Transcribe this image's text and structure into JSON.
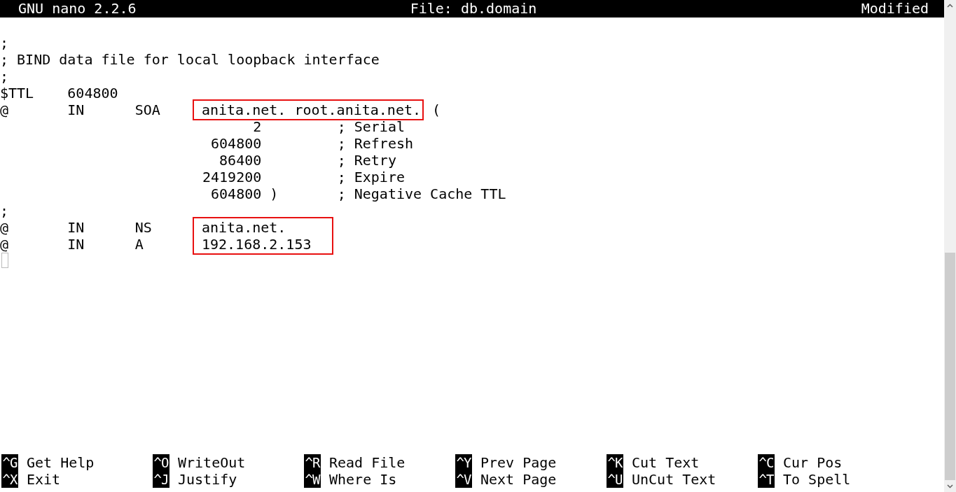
{
  "title_bar": {
    "app": "GNU nano 2.2.6",
    "file": "File: db.domain",
    "status": "Modified"
  },
  "editor": {
    "lines": [
      {
        "kind": "blank"
      },
      {
        "kind": "line",
        "text": ";"
      },
      {
        "kind": "line",
        "text": "; BIND data file for local loopback interface"
      },
      {
        "kind": "line",
        "text": ";"
      },
      {
        "kind": "line",
        "text": "$TTL    604800"
      },
      {
        "kind": "annotated",
        "rows": [
          {
            "lead": "@       IN      SOA    ",
            "value": "anita.net. root.anita.net.",
            "tail": " ("
          }
        ]
      },
      {
        "kind": "line",
        "text": "                              2         ; Serial"
      },
      {
        "kind": "line",
        "text": "                         604800         ; Refresh"
      },
      {
        "kind": "line",
        "text": "                          86400         ; Retry"
      },
      {
        "kind": "line",
        "text": "                        2419200         ; Expire"
      },
      {
        "kind": "line",
        "text": "                         604800 )       ; Negative Cache TTL"
      },
      {
        "kind": "line",
        "text": ";"
      },
      {
        "kind": "annotated",
        "rows": [
          {
            "lead": "@       IN      NS     ",
            "value": "anita.net."
          },
          {
            "lead": "@       IN      A      ",
            "value": "192.168.2.153"
          }
        ]
      },
      {
        "kind": "cursor"
      }
    ]
  },
  "shortcuts": [
    [
      {
        "key": "^G",
        "label": "Get Help"
      },
      {
        "key": "^O",
        "label": "WriteOut"
      },
      {
        "key": "^R",
        "label": "Read File"
      },
      {
        "key": "^Y",
        "label": "Prev Page"
      },
      {
        "key": "^K",
        "label": "Cut Text"
      },
      {
        "key": "^C",
        "label": "Cur Pos"
      }
    ],
    [
      {
        "key": "^X",
        "label": "Exit"
      },
      {
        "key": "^J",
        "label": "Justify"
      },
      {
        "key": "^W",
        "label": "Where Is"
      },
      {
        "key": "^V",
        "label": "Next Page"
      },
      {
        "key": "^U",
        "label": "UnCut Text"
      },
      {
        "key": "^T",
        "label": "To Spell"
      }
    ]
  ]
}
